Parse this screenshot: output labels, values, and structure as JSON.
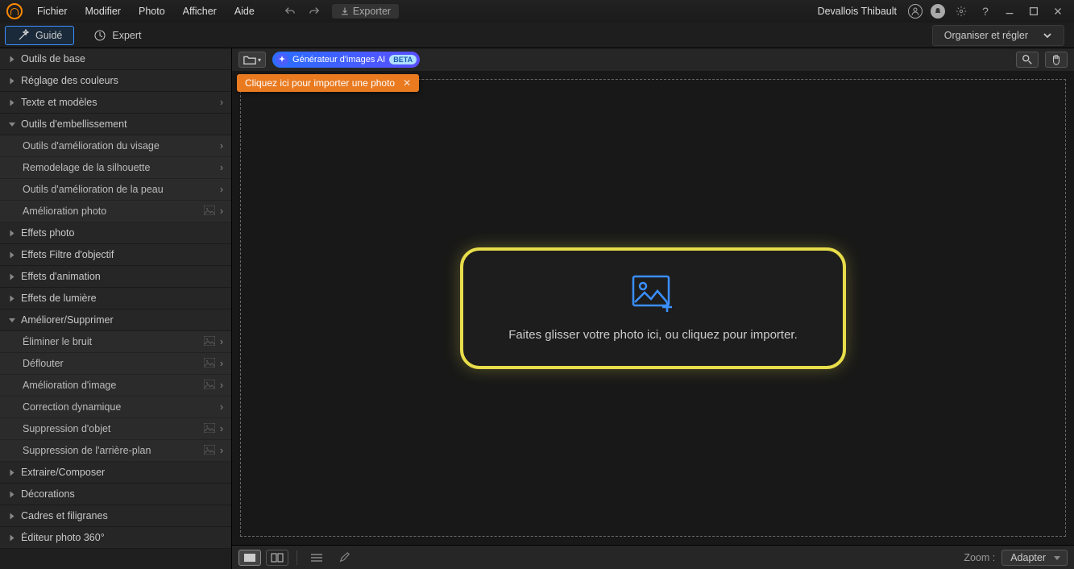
{
  "titlebar": {
    "menu": [
      "Fichier",
      "Modifier",
      "Photo",
      "Afficher",
      "Aide"
    ],
    "export": "Exporter",
    "user": "Devallois Thibault"
  },
  "modebar": {
    "guided": "Guidé",
    "expert": "Expert",
    "organiser": "Organiser et régler"
  },
  "sidebar": {
    "items": [
      {
        "label": "Outils de base",
        "type": "top",
        "collapsed": true
      },
      {
        "label": "Réglage des couleurs",
        "type": "top",
        "collapsed": true
      },
      {
        "label": "Texte et modèles",
        "type": "top",
        "collapsed": true,
        "chev": true
      },
      {
        "label": "Outils d'embellissement",
        "type": "top",
        "expanded": true
      },
      {
        "label": "Outils d'amélioration du visage",
        "type": "sub",
        "chev": true
      },
      {
        "label": "Remodelage de la silhouette",
        "type": "sub",
        "chev": true
      },
      {
        "label": "Outils d'amélioration de la peau",
        "type": "sub",
        "chev": true
      },
      {
        "label": "Amélioration photo",
        "type": "sub",
        "chev": true,
        "badge": true
      },
      {
        "label": "Effets photo",
        "type": "top",
        "collapsed": true
      },
      {
        "label": "Effets Filtre d'objectif",
        "type": "top",
        "collapsed": true
      },
      {
        "label": "Effets d'animation",
        "type": "top",
        "collapsed": true
      },
      {
        "label": "Effets de lumière",
        "type": "top",
        "collapsed": true
      },
      {
        "label": "Améliorer/Supprimer",
        "type": "top",
        "expanded": true
      },
      {
        "label": "Éliminer le bruit",
        "type": "sub",
        "chev": true,
        "badge": true
      },
      {
        "label": "Déflouter",
        "type": "sub",
        "chev": true,
        "badge": true
      },
      {
        "label": "Amélioration d'image",
        "type": "sub",
        "chev": true,
        "badge": true
      },
      {
        "label": "Correction dynamique",
        "type": "sub",
        "chev": true
      },
      {
        "label": "Suppression d'objet",
        "type": "sub",
        "chev": true,
        "badge": true
      },
      {
        "label": "Suppression de l'arrière-plan",
        "type": "sub",
        "chev": true,
        "badge": true
      },
      {
        "label": "Extraire/Composer",
        "type": "top",
        "collapsed": true
      },
      {
        "label": "Décorations",
        "type": "top",
        "collapsed": true
      },
      {
        "label": "Cadres et filigranes",
        "type": "top",
        "collapsed": true
      },
      {
        "label": "Éditeur photo 360°",
        "type": "top",
        "collapsed": true
      }
    ]
  },
  "canvas": {
    "ai_label": "Générateur d'images  AI",
    "beta": "BETA",
    "tooltip": "Cliquez ici pour importer une photo",
    "drop": "Faites glisser votre photo ici, ou cliquez pour importer."
  },
  "bottom": {
    "zoom_label": "Zoom :",
    "zoom_value": "Adapter"
  }
}
